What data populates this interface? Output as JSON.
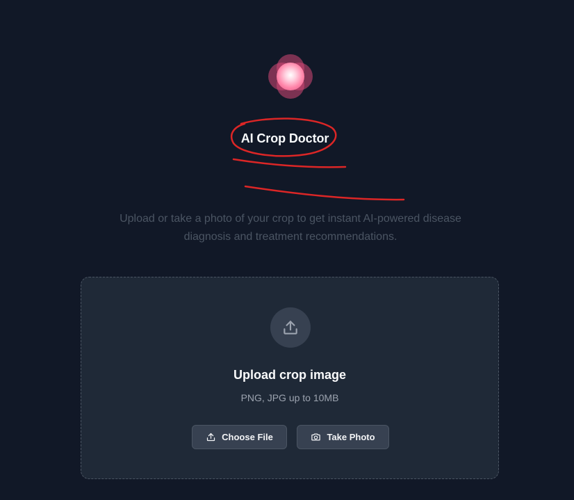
{
  "app": {
    "title": "AI Crop Doctor"
  },
  "intro": {
    "text": "Upload or take a photo of your crop to get instant AI-powered disease diagnosis and treatment recommendations."
  },
  "upload": {
    "title": "Upload crop image",
    "hint": "PNG, JPG up to 10MB",
    "choose_file_label": "Choose File",
    "take_photo_label": "Take Photo"
  },
  "colors": {
    "background": "#111827",
    "panel": "#1f2937",
    "annotation": "#dc2626",
    "logo_accent": "#ff86aa"
  },
  "icons": {
    "logo": "pink-orb-icon",
    "upload": "upload-icon",
    "choose_file": "upload-icon",
    "take_photo": "camera-icon"
  }
}
